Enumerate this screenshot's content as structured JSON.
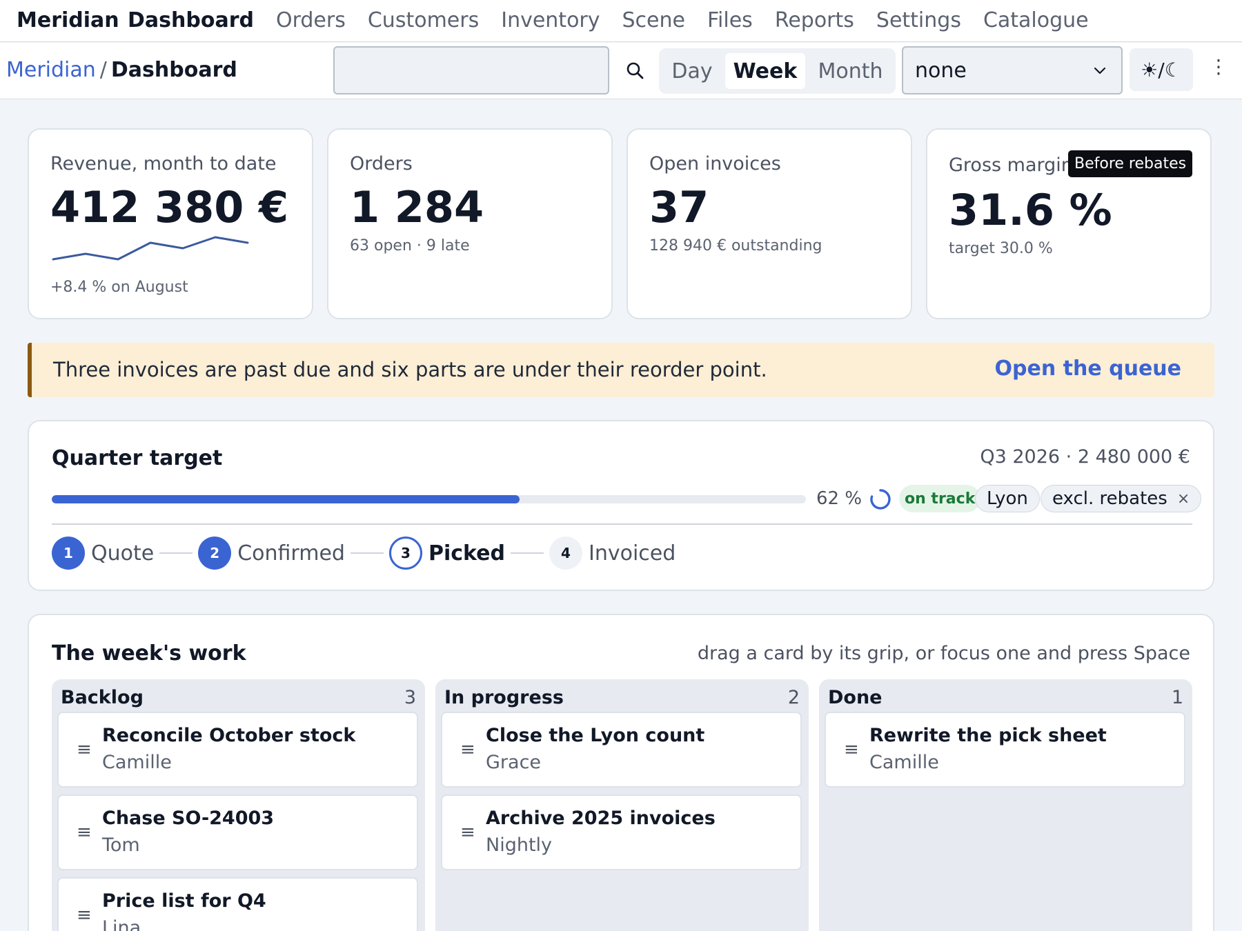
{
  "nav": {
    "brand": "Meridian",
    "items": [
      {
        "label": "Dashboard",
        "active": true
      },
      {
        "label": "Orders"
      },
      {
        "label": "Customers"
      },
      {
        "label": "Inventory"
      },
      {
        "label": "Scene"
      },
      {
        "label": "Files"
      },
      {
        "label": "Reports"
      },
      {
        "label": "Settings"
      },
      {
        "label": "Catalogue"
      }
    ]
  },
  "breadcrumb": {
    "root": "Meridian",
    "separator": "/",
    "current": "Dashboard"
  },
  "search": {
    "value": "",
    "placeholder": ""
  },
  "range": {
    "options": [
      "Day",
      "Week",
      "Month"
    ],
    "selected": "Week"
  },
  "filter_select": {
    "value": "none"
  },
  "theme_toggle": {
    "label": "☀/☾"
  },
  "kpis": {
    "revenue": {
      "label": "Revenue, month to date",
      "value": "412 380 €",
      "note": "+8.4 % on August",
      "trend": [
        2,
        3,
        2,
        5,
        4,
        6,
        5
      ]
    },
    "orders": {
      "label": "Orders",
      "value": "1 284",
      "sub": "63 open · 9 late"
    },
    "invoices": {
      "label": "Open invoices",
      "value": "37",
      "sub": "128 940 € outstanding"
    },
    "margin": {
      "label": "Gross margin",
      "tooltip": "Before rebates",
      "value": "31.6 %",
      "sub": "target 30.0 %"
    }
  },
  "alert": {
    "text": "Three invoices are past due and six parts are under their reorder point.",
    "link": "Open the queue"
  },
  "quarter_target": {
    "title": "Quarter target",
    "meta": "Q3 2026 · 2 480 000 €",
    "progress": 62,
    "progress_label": "62 %",
    "status": "on track",
    "chips": [
      {
        "label": "Lyon"
      },
      {
        "label": "excl. rebates",
        "close": "×"
      }
    ],
    "steps": [
      {
        "num": "1",
        "label": "Quote",
        "state": "done"
      },
      {
        "num": "2",
        "label": "Confirmed",
        "state": "done"
      },
      {
        "num": "3",
        "label": "Picked",
        "state": "current"
      },
      {
        "num": "4",
        "label": "Invoiced",
        "state": "todo"
      }
    ]
  },
  "board": {
    "title": "The week's work",
    "hint": "drag a card by its grip, or focus one and press Space",
    "grip_icon": "≡",
    "columns": [
      {
        "title": "Backlog",
        "count": "3",
        "cards": [
          {
            "title": "Reconcile October stock",
            "owner": "Camille"
          },
          {
            "title": "Chase SO-24003",
            "owner": "Tom"
          },
          {
            "title": "Price list for Q4",
            "owner": "Lina"
          }
        ]
      },
      {
        "title": "In progress",
        "count": "2",
        "cards": [
          {
            "title": "Close the Lyon count",
            "owner": "Grace"
          },
          {
            "title": "Archive 2025 invoices",
            "owner": "Nightly"
          }
        ]
      },
      {
        "title": "Done",
        "count": "1",
        "cards": [
          {
            "title": "Rewrite the pick sheet",
            "owner": "Camille"
          }
        ]
      }
    ]
  },
  "colors": {
    "accent": "#3a64d2",
    "alert_bg": "#fdeed6",
    "alert_border": "#8a5a12",
    "success": "#1c7a3a"
  }
}
